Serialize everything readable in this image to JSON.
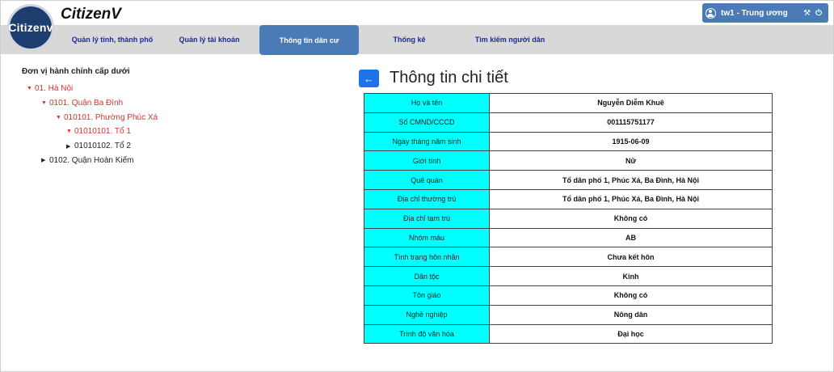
{
  "app": {
    "logo_text": "Citizenv",
    "title": "CitizenV"
  },
  "nav": [
    {
      "label": "Quản lý tỉnh, thành phố",
      "active": false
    },
    {
      "label": "Quản lý tài khoản",
      "active": false
    },
    {
      "label": "Thông tin dân cư",
      "active": true
    },
    {
      "label": "Thống kê",
      "active": false
    },
    {
      "label": "Tìm kiếm người dân",
      "active": false
    }
  ],
  "user": {
    "name": "tw1 - Trung ương",
    "settings_icon": "tools-icon",
    "logout_icon": "logout-icon"
  },
  "tree": {
    "title": "Đơn vị hành chính cấp dưới",
    "items": [
      {
        "label": "01. Hà Nội",
        "level": 0,
        "expanded": true,
        "selected": true
      },
      {
        "label": "0101. Quận Ba Đình",
        "level": 1,
        "expanded": true,
        "selected": true
      },
      {
        "label": "010101. Phường Phúc Xá",
        "level": 2,
        "expanded": true,
        "selected": true
      },
      {
        "label": "01010101. Tổ 1",
        "level": 3,
        "expanded": true,
        "selected": true
      },
      {
        "label": "01010102. Tổ 2",
        "level": 3,
        "expanded": false,
        "selected": false
      },
      {
        "label": "0102. Quận Hoàn Kiếm",
        "level": 1,
        "expanded": false,
        "selected": false
      }
    ]
  },
  "detail": {
    "back_label": "←",
    "title": "Thông tin chi tiết",
    "rows": [
      {
        "key": "Họ và tên",
        "value": "Nguyễn Diễm Khuê"
      },
      {
        "key": "Số CMND/CCCD",
        "value": "001115751177"
      },
      {
        "key": "Ngày tháng năm sinh",
        "value": "1915-06-09"
      },
      {
        "key": "Giới tính",
        "value": "Nữ"
      },
      {
        "key": "Quê quán",
        "value": "Tổ dân phố 1, Phúc Xá, Ba Đình, Hà Nội"
      },
      {
        "key": "Địa chỉ thường trú",
        "value": "Tổ dân phố 1, Phúc Xá, Ba Đình, Hà Nội"
      },
      {
        "key": "Địa chỉ tạm trú",
        "value": "Không có"
      },
      {
        "key": "Nhóm máu",
        "value": "AB"
      },
      {
        "key": "Tình trạng hôn nhân",
        "value": "Chưa kết hôn"
      },
      {
        "key": "Dân tộc",
        "value": "Kinh"
      },
      {
        "key": "Tôn giáo",
        "value": "Không có"
      },
      {
        "key": "Nghề nghiệp",
        "value": "Nông dân"
      },
      {
        "key": "Trình độ văn hóa",
        "value": "Đại học"
      }
    ]
  },
  "colors": {
    "accent": "#4a7bb7",
    "key_cell": "#00ffff",
    "tree_selected": "#e03030",
    "back_button": "#1f72e8"
  }
}
